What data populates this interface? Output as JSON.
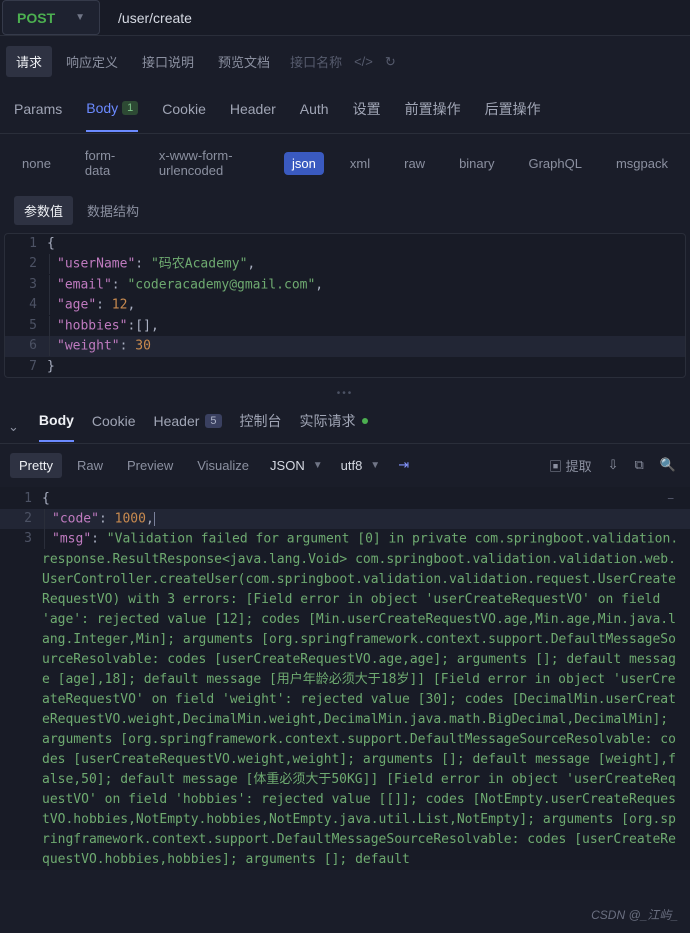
{
  "method": "POST",
  "url": "/user/create",
  "tabs1": [
    "请求",
    "响应定义",
    "接口说明",
    "预览文档"
  ],
  "tabs1_active": 0,
  "api_name_placeholder": "接口名称",
  "tabs2": [
    "Params",
    "Body",
    "Cookie",
    "Header",
    "Auth",
    "设置",
    "前置操作",
    "后置操作"
  ],
  "tabs2_active": 1,
  "tabs2_badge": "1",
  "body_types": [
    "none",
    "form-data",
    "x-www-form-urlencoded",
    "json",
    "xml",
    "raw",
    "binary",
    "GraphQL",
    "msgpack"
  ],
  "body_types_active": 3,
  "sub_tabs": [
    "参数值",
    "数据结构"
  ],
  "sub_tabs_active": 0,
  "request_json": {
    "lines": [
      "1",
      "2",
      "3",
      "4",
      "5",
      "6",
      "7"
    ],
    "keys": {
      "userName": "userName",
      "email": "email",
      "age": "age",
      "hobbies": "hobbies",
      "weight": "weight"
    },
    "values": {
      "userName": "码农Academy",
      "email": "coderacademy@gmail.com",
      "age": "12",
      "hobbiesRaw": "[]",
      "weight": "30"
    }
  },
  "response_tabs": [
    "Body",
    "Cookie",
    "Header",
    "控制台",
    "实际请求"
  ],
  "response_tabs_active": 0,
  "response_header_badge": "5",
  "view_tabs": [
    "Pretty",
    "Raw",
    "Preview",
    "Visualize"
  ],
  "view_tabs_active": 0,
  "content_type": "JSON",
  "encoding": "utf8",
  "extract_label": "提取",
  "response_json": {
    "code_key": "code",
    "code_val": "1000",
    "msg_key": "msg",
    "msg_val": "Validation failed for argument [0] in private com.springboot.validation.response.ResultResponse<java.lang.Void> com.springboot.validation.validation.web.UserController.createUser(com.springboot.validation.validation.request.UserCreateRequestVO) with 3 errors: [Field error in object 'userCreateRequestVO' on field 'age': rejected value [12]; codes [Min.userCreateRequestVO.age,Min.age,Min.java.lang.Integer,Min]; arguments [org.springframework.context.support.DefaultMessageSourceResolvable: codes [userCreateRequestVO.age,age]; arguments []; default message [age],18]; default message [用户年龄必须大于18岁]] [Field error in object 'userCreateRequestVO' on field 'weight': rejected value [30]; codes [DecimalMin.userCreateRequestVO.weight,DecimalMin.weight,DecimalMin.java.math.BigDecimal,DecimalMin]; arguments [org.springframework.context.support.DefaultMessageSourceResolvable: codes [userCreateRequestVO.weight,weight]; arguments []; default message [weight],false,50]; default message [体重必须大于50KG]] [Field error in object 'userCreateRequestVO' on field 'hobbies': rejected value [[]]; codes [NotEmpty.userCreateRequestVO.hobbies,NotEmpty.hobbies,NotEmpty.java.util.List,NotEmpty]; arguments [org.springframework.context.support.DefaultMessageSourceResolvable: codes [userCreateRequestVO.hobbies,hobbies]; arguments []; default"
  },
  "watermark": "CSDN @_江屿_"
}
